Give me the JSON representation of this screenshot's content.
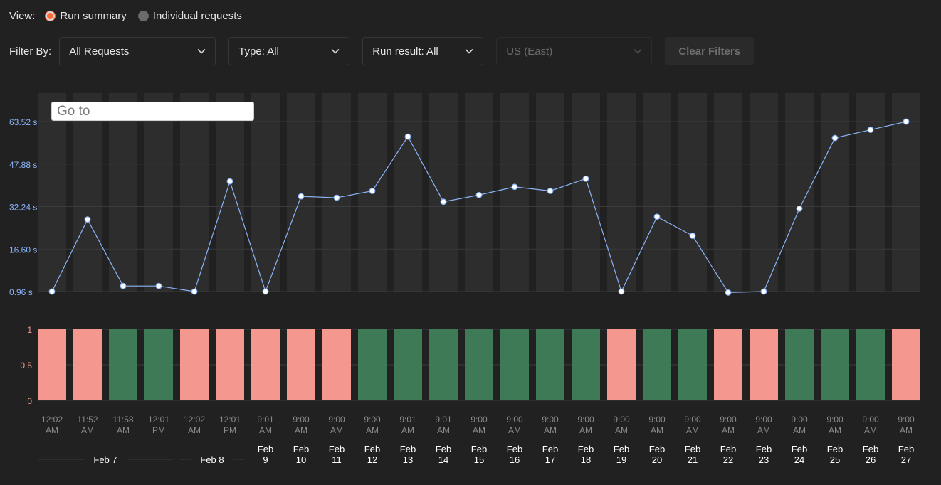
{
  "view": {
    "label": "View:",
    "options": [
      {
        "label": "Run summary",
        "selected": true
      },
      {
        "label": "Individual requests",
        "selected": false
      }
    ]
  },
  "filters": {
    "label": "Filter By:",
    "requests": "All Requests",
    "type": "Type: All",
    "run_result": "Run result: All",
    "region": "US (East)",
    "clear_button": "Clear Filters"
  },
  "goto_placeholder": "Go to",
  "colors": {
    "line": "#8ab4f8",
    "axis_label": "#8ab4f8",
    "fail": "#f4978e",
    "pass": "#3f7a57",
    "column_bg": "#2d2d2d",
    "accent": "#ff6c37"
  },
  "chart_data": [
    {
      "type": "line",
      "yticks": [
        "63.52 s",
        "47.88 s",
        "32.24 s",
        "16.60 s",
        "0.96 s"
      ],
      "ylim": [
        0.96,
        63.52
      ],
      "x": [
        "12:02 AM",
        "11:52 AM",
        "11:58 AM",
        "12:01 PM",
        "12:02 AM",
        "12:01 PM",
        "9:01 AM",
        "9:00 AM",
        "9:00 AM",
        "9:00 AM",
        "9:01 AM",
        "9:01 AM",
        "9:00 AM",
        "9:00 AM",
        "9:00 AM",
        "9:00 AM",
        "9:00 AM",
        "9:00 AM",
        "9:00 AM",
        "9:00 AM",
        "9:00 AM",
        "9:00 AM",
        "9:00 AM",
        "9:00 AM",
        "9:00 AM"
      ],
      "values": [
        0.96,
        27.5,
        3.0,
        3.0,
        0.96,
        41.5,
        0.96,
        36.0,
        35.5,
        38.0,
        58.0,
        34.0,
        36.5,
        39.5,
        38.0,
        42.5,
        0.96,
        28.5,
        21.5,
        0.6,
        0.96,
        31.5,
        57.5,
        60.5,
        63.52
      ],
      "grid": true
    },
    {
      "type": "bar",
      "yticks": [
        "1",
        "0.5",
        "0"
      ],
      "ylim": [
        0,
        1
      ],
      "values": [
        1,
        1,
        1,
        1,
        1,
        1,
        1,
        1,
        1,
        1,
        1,
        1,
        1,
        1,
        1,
        1,
        1,
        1,
        1,
        1,
        1,
        1,
        1,
        1,
        1
      ],
      "result": [
        "fail",
        "fail",
        "pass",
        "pass",
        "fail",
        "fail",
        "fail",
        "fail",
        "fail",
        "pass",
        "pass",
        "pass",
        "pass",
        "pass",
        "pass",
        "pass",
        "fail",
        "pass",
        "pass",
        "fail",
        "fail",
        "pass",
        "pass",
        "pass",
        "fail"
      ]
    }
  ],
  "time_labels": [
    [
      "12:02",
      "AM"
    ],
    [
      "11:52",
      "AM"
    ],
    [
      "11:58",
      "AM"
    ],
    [
      "12:01",
      "PM"
    ],
    [
      "12:02",
      "AM"
    ],
    [
      "12:01",
      "PM"
    ],
    [
      "9:01",
      "AM"
    ],
    [
      "9:00",
      "AM"
    ],
    [
      "9:00",
      "AM"
    ],
    [
      "9:00",
      "AM"
    ],
    [
      "9:01",
      "AM"
    ],
    [
      "9:01",
      "AM"
    ],
    [
      "9:00",
      "AM"
    ],
    [
      "9:00",
      "AM"
    ],
    [
      "9:00",
      "AM"
    ],
    [
      "9:00",
      "AM"
    ],
    [
      "9:00",
      "AM"
    ],
    [
      "9:00",
      "AM"
    ],
    [
      "9:00",
      "AM"
    ],
    [
      "9:00",
      "AM"
    ],
    [
      "9:00",
      "AM"
    ],
    [
      "9:00",
      "AM"
    ],
    [
      "9:00",
      "AM"
    ],
    [
      "9:00",
      "AM"
    ],
    [
      "9:00",
      "AM"
    ]
  ],
  "group_dates": [
    {
      "label": "Feb 7",
      "first": 0,
      "last": 3
    },
    {
      "label": "Feb 8",
      "first": 4,
      "last": 5
    }
  ],
  "single_dates": [
    {
      "index": 6,
      "month": "Feb",
      "day": "9"
    },
    {
      "index": 7,
      "month": "Feb",
      "day": "10"
    },
    {
      "index": 8,
      "month": "Feb",
      "day": "11"
    },
    {
      "index": 9,
      "month": "Feb",
      "day": "12"
    },
    {
      "index": 10,
      "month": "Feb",
      "day": "13"
    },
    {
      "index": 11,
      "month": "Feb",
      "day": "14"
    },
    {
      "index": 12,
      "month": "Feb",
      "day": "15"
    },
    {
      "index": 13,
      "month": "Feb",
      "day": "16"
    },
    {
      "index": 14,
      "month": "Feb",
      "day": "17"
    },
    {
      "index": 15,
      "month": "Feb",
      "day": "18"
    },
    {
      "index": 16,
      "month": "Feb",
      "day": "19"
    },
    {
      "index": 17,
      "month": "Feb",
      "day": "20"
    },
    {
      "index": 18,
      "month": "Feb",
      "day": "21"
    },
    {
      "index": 19,
      "month": "Feb",
      "day": "22"
    },
    {
      "index": 20,
      "month": "Feb",
      "day": "23"
    },
    {
      "index": 21,
      "month": "Feb",
      "day": "24"
    },
    {
      "index": 22,
      "month": "Feb",
      "day": "25"
    },
    {
      "index": 23,
      "month": "Feb",
      "day": "26"
    },
    {
      "index": 24,
      "month": "Feb",
      "day": "27"
    }
  ]
}
